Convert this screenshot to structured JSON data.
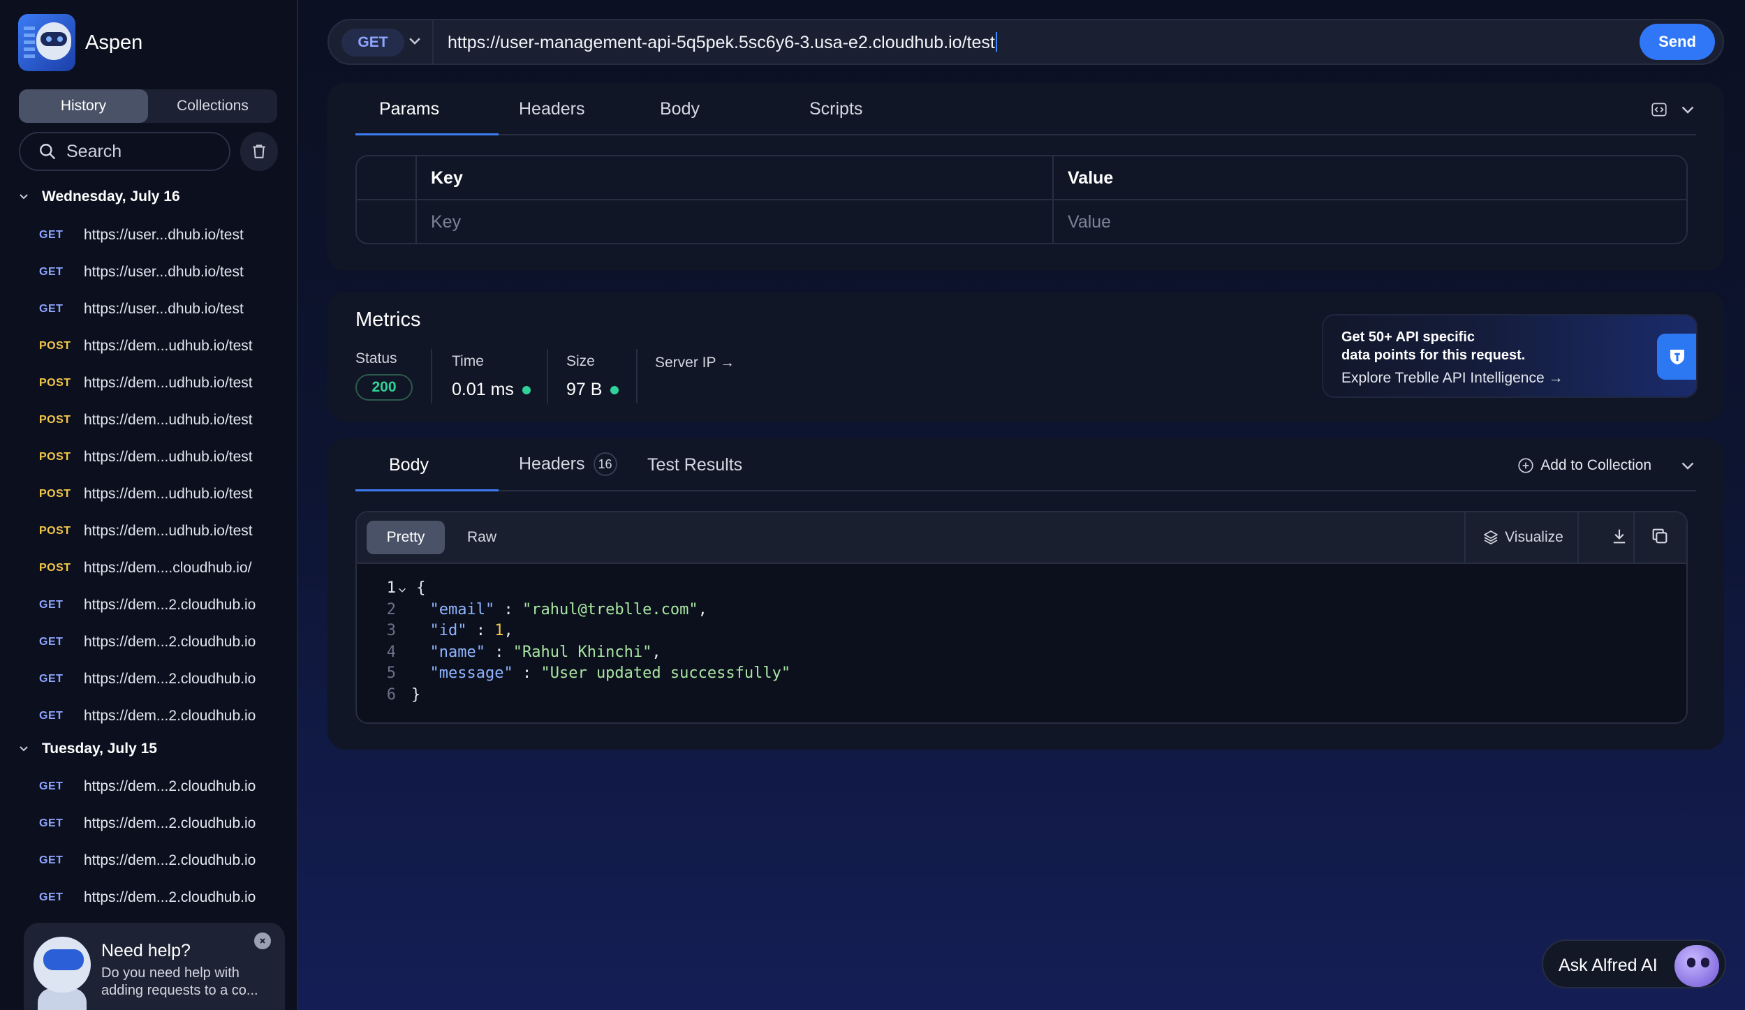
{
  "app": {
    "name": "Aspen"
  },
  "sidebar": {
    "tabs": [
      {
        "label": "History"
      },
      {
        "label": "Collections"
      }
    ],
    "search_label": "Search",
    "groups": [
      {
        "label": "Wednesday, July 16"
      },
      {
        "label": "Tuesday, July 15"
      }
    ],
    "items_wed": [
      {
        "method": "GET",
        "url": "https://user...dhub.io/test"
      },
      {
        "method": "GET",
        "url": "https://user...dhub.io/test"
      },
      {
        "method": "GET",
        "url": "https://user...dhub.io/test"
      },
      {
        "method": "POST",
        "url": "https://dem...udhub.io/test"
      },
      {
        "method": "POST",
        "url": "https://dem...udhub.io/test"
      },
      {
        "method": "POST",
        "url": "https://dem...udhub.io/test"
      },
      {
        "method": "POST",
        "url": "https://dem...udhub.io/test"
      },
      {
        "method": "POST",
        "url": "https://dem...udhub.io/test"
      },
      {
        "method": "POST",
        "url": "https://dem...udhub.io/test"
      },
      {
        "method": "POST",
        "url": "https://dem....cloudhub.io/"
      },
      {
        "method": "GET",
        "url": "https://dem...2.cloudhub.io"
      },
      {
        "method": "GET",
        "url": "https://dem...2.cloudhub.io"
      },
      {
        "method": "GET",
        "url": "https://dem...2.cloudhub.io"
      },
      {
        "method": "GET",
        "url": "https://dem...2.cloudhub.io"
      }
    ],
    "items_tue": [
      {
        "method": "GET",
        "url": "https://dem...2.cloudhub.io"
      },
      {
        "method": "GET",
        "url": "https://dem...2.cloudhub.io"
      },
      {
        "method": "GET",
        "url": "https://dem...2.cloudhub.io"
      },
      {
        "method": "GET",
        "url": "https://dem...2.cloudhub.io"
      }
    ],
    "help": {
      "title": "Need help?",
      "text": "Do you need help with adding requests to a co..."
    }
  },
  "request": {
    "method": "GET",
    "url": "https://user-management-api-5q5pek.5sc6y6-3.usa-e2.cloudhub.io/test",
    "send_label": "Send",
    "tabs": [
      {
        "label": "Params"
      },
      {
        "label": "Headers"
      },
      {
        "label": "Body"
      },
      {
        "label": "Scripts"
      }
    ],
    "params": {
      "key_header": "Key",
      "value_header": "Value",
      "key_placeholder": "Key",
      "value_placeholder": "Value"
    }
  },
  "metrics": {
    "title": "Metrics",
    "status_label": "Status",
    "status_value": "200",
    "time_label": "Time",
    "time_value": "0.01 ms",
    "size_label": "Size",
    "size_value": "97 B",
    "server_ip_label": "Server IP →",
    "promo": {
      "line1": "Get 50+ API specific",
      "line2": "data points for this request.",
      "link": "Explore Treblle API Intelligence →"
    }
  },
  "response": {
    "tabs": [
      {
        "label": "Body"
      },
      {
        "label": "Headers",
        "badge": "16"
      },
      {
        "label": "Test Results"
      }
    ],
    "add_to_collection": "Add to Collection",
    "view_modes": [
      {
        "label": "Pretty"
      },
      {
        "label": "Raw"
      }
    ],
    "visualize_label": "Visualize",
    "line_numbers": [
      "1",
      "2",
      "3",
      "4",
      "5",
      "6"
    ],
    "json": {
      "email_key": "\"email\"",
      "email_val": "\"rahul@treblle.com\"",
      "id_key": "\"id\"",
      "id_val": "1",
      "name_key": "\"name\"",
      "name_val": "\"Rahul Khinchi\"",
      "message_key": "\"message\"",
      "message_val": "\"User updated successfully\""
    }
  },
  "assistant": {
    "label": "Ask Alfred AI"
  },
  "colors": {
    "accent": "#2f77f6",
    "get": "#8fa6ff",
    "post": "#f4c84a",
    "success": "#2fd39a"
  }
}
